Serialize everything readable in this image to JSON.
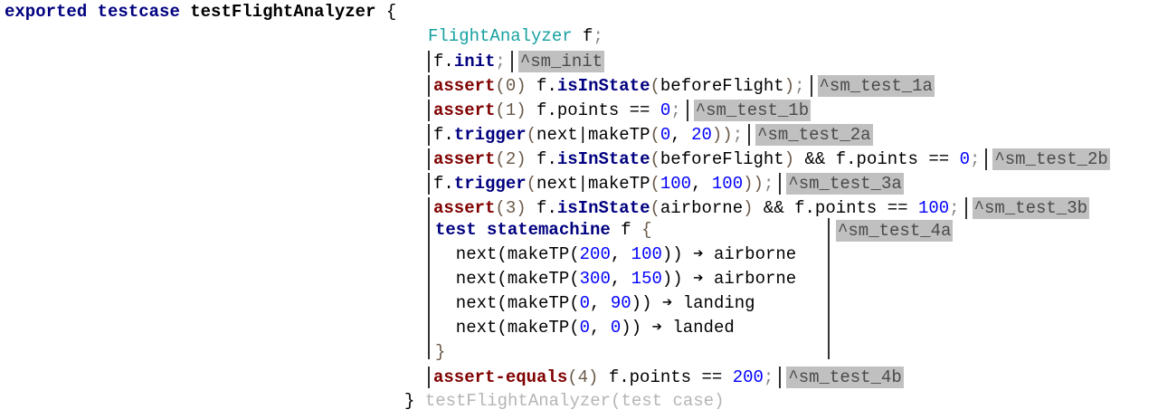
{
  "header": [
    {
      "c": "kw",
      "t": "exported"
    },
    {
      "c": "x",
      "t": " "
    },
    {
      "c": "kw",
      "t": "testcase"
    },
    {
      "c": "x",
      "t": " "
    },
    {
      "c": "b",
      "t": "testFlightAnalyzer"
    },
    {
      "c": "x",
      "t": " {"
    }
  ],
  "declaration": [
    {
      "c": "t",
      "t": "FlightAnalyzer"
    },
    {
      "c": "x",
      "t": " f"
    },
    {
      "c": "sc",
      "t": ";"
    }
  ],
  "statements": [
    {
      "segs": [
        {
          "c": "x",
          "t": "f."
        },
        {
          "c": "kw",
          "t": "init"
        },
        {
          "c": "sc",
          "t": ";"
        }
      ],
      "label": "^sm_init"
    },
    {
      "segs": [
        {
          "c": "as",
          "t": "assert"
        },
        {
          "c": "p",
          "t": "(0)"
        },
        {
          "c": "x",
          "t": " f."
        },
        {
          "c": "kw",
          "t": "isInState"
        },
        {
          "c": "p",
          "t": "("
        },
        {
          "c": "x",
          "t": "beforeFlight"
        },
        {
          "c": "p",
          "t": ")"
        },
        {
          "c": "sc",
          "t": ";"
        }
      ],
      "label": "^sm_test_1a"
    },
    {
      "segs": [
        {
          "c": "as",
          "t": "assert"
        },
        {
          "c": "p",
          "t": "(1)"
        },
        {
          "c": "x",
          "t": " f.points == "
        },
        {
          "c": "n",
          "t": "0"
        },
        {
          "c": "sc",
          "t": ";"
        }
      ],
      "label": "^sm_test_1b"
    },
    {
      "segs": [
        {
          "c": "x",
          "t": "f."
        },
        {
          "c": "kw",
          "t": "trigger"
        },
        {
          "c": "p",
          "t": "("
        },
        {
          "c": "x",
          "t": "next|makeTP"
        },
        {
          "c": "p",
          "t": "("
        },
        {
          "c": "n",
          "t": "0"
        },
        {
          "c": "x",
          "t": ", "
        },
        {
          "c": "n",
          "t": "20"
        },
        {
          "c": "p",
          "t": "))"
        },
        {
          "c": "sc",
          "t": ";"
        }
      ],
      "label": "^sm_test_2a"
    },
    {
      "segs": [
        {
          "c": "as",
          "t": "assert"
        },
        {
          "c": "p",
          "t": "(2)"
        },
        {
          "c": "x",
          "t": " f."
        },
        {
          "c": "kw",
          "t": "isInState"
        },
        {
          "c": "p",
          "t": "("
        },
        {
          "c": "x",
          "t": "beforeFlight"
        },
        {
          "c": "p",
          "t": ")"
        },
        {
          "c": "x",
          "t": " && f.points == "
        },
        {
          "c": "n",
          "t": "0"
        },
        {
          "c": "sc",
          "t": ";"
        }
      ],
      "label": "^sm_test_2b"
    },
    {
      "segs": [
        {
          "c": "x",
          "t": "f."
        },
        {
          "c": "kw",
          "t": "trigger"
        },
        {
          "c": "p",
          "t": "("
        },
        {
          "c": "x",
          "t": "next|makeTP"
        },
        {
          "c": "p",
          "t": "("
        },
        {
          "c": "n",
          "t": "100"
        },
        {
          "c": "x",
          "t": ", "
        },
        {
          "c": "n",
          "t": "100"
        },
        {
          "c": "p",
          "t": "))"
        },
        {
          "c": "sc",
          "t": ";"
        }
      ],
      "label": "^sm_test_3a"
    },
    {
      "segs": [
        {
          "c": "as",
          "t": "assert"
        },
        {
          "c": "p",
          "t": "(3)"
        },
        {
          "c": "x",
          "t": " f."
        },
        {
          "c": "kw",
          "t": "isInState"
        },
        {
          "c": "p",
          "t": "("
        },
        {
          "c": "x",
          "t": "airborne"
        },
        {
          "c": "p",
          "t": ")"
        },
        {
          "c": "x",
          "t": " && f.points == "
        },
        {
          "c": "n",
          "t": "100"
        },
        {
          "c": "sc",
          "t": ";"
        }
      ],
      "label": "^sm_test_3b"
    }
  ],
  "statemachine_test": {
    "header": [
      {
        "c": "kw",
        "t": "test"
      },
      {
        "c": "x",
        "t": " "
      },
      {
        "c": "kw",
        "t": "statemachine"
      },
      {
        "c": "x",
        "t": " f "
      },
      {
        "c": "p",
        "t": "{"
      }
    ],
    "steps": [
      [
        {
          "c": "x",
          "t": "  next(makeTP("
        },
        {
          "c": "n",
          "t": "200"
        },
        {
          "c": "x",
          "t": ", "
        },
        {
          "c": "n",
          "t": "100"
        },
        {
          "c": "x",
          "t": ")) "
        },
        {
          "c": "ar",
          "t": "➔"
        },
        {
          "c": "x",
          "t": " airborne"
        }
      ],
      [
        {
          "c": "x",
          "t": "  next(makeTP("
        },
        {
          "c": "n",
          "t": "300"
        },
        {
          "c": "x",
          "t": ", "
        },
        {
          "c": "n",
          "t": "150"
        },
        {
          "c": "x",
          "t": ")) "
        },
        {
          "c": "ar",
          "t": "➔"
        },
        {
          "c": "x",
          "t": " airborne"
        }
      ],
      [
        {
          "c": "x",
          "t": "  next(makeTP("
        },
        {
          "c": "n",
          "t": "0"
        },
        {
          "c": "x",
          "t": ", "
        },
        {
          "c": "n",
          "t": "90"
        },
        {
          "c": "x",
          "t": ")) "
        },
        {
          "c": "ar",
          "t": "➔"
        },
        {
          "c": "x",
          "t": " landing"
        }
      ],
      [
        {
          "c": "x",
          "t": "  next(makeTP("
        },
        {
          "c": "n",
          "t": "0"
        },
        {
          "c": "x",
          "t": ", "
        },
        {
          "c": "n",
          "t": "0"
        },
        {
          "c": "x",
          "t": ")) "
        },
        {
          "c": "ar",
          "t": "➔"
        },
        {
          "c": "x",
          "t": " landed"
        }
      ]
    ],
    "closing": [
      {
        "c": "p",
        "t": "}"
      }
    ],
    "label": "^sm_test_4a"
  },
  "final_statement": {
    "segs": [
      {
        "c": "as",
        "t": "assert-equals"
      },
      {
        "c": "p",
        "t": "(4)"
      },
      {
        "c": "x",
        "t": " f.points == "
      },
      {
        "c": "n",
        "t": "200"
      },
      {
        "c": "sc",
        "t": ";"
      }
    ],
    "label": "^sm_test_4b"
  },
  "footer": [
    {
      "c": "x",
      "t": "} "
    },
    {
      "c": "g",
      "t": "testFlightAnalyzer(test case)"
    }
  ]
}
